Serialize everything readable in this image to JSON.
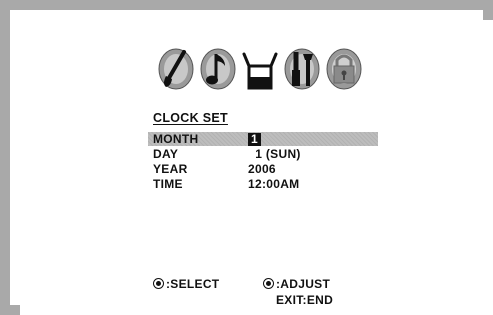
{
  "menu": {
    "icons": [
      {
        "name": "picture-brush-icon"
      },
      {
        "name": "sound-note-icon"
      },
      {
        "name": "channel-antenna-icon"
      },
      {
        "name": "setup-tools-icon"
      },
      {
        "name": "lock-icon"
      }
    ],
    "title": "CLOCK SET",
    "rows": [
      {
        "label": "MONTH",
        "value": "1",
        "selected": true
      },
      {
        "label": "DAY",
        "value": "  1 (SUN)",
        "selected": false
      },
      {
        "label": "YEAR",
        "value": "2006",
        "selected": false
      },
      {
        "label": "TIME",
        "value": "12:00AM",
        "selected": false
      }
    ]
  },
  "footer": {
    "select_label": ":SELECT",
    "adjust_label": ":ADJUST",
    "exit_label": "EXIT:END"
  },
  "colors": {
    "border": "#a9a9a9",
    "highlight": "#bdbdbd",
    "text": "#111111"
  }
}
